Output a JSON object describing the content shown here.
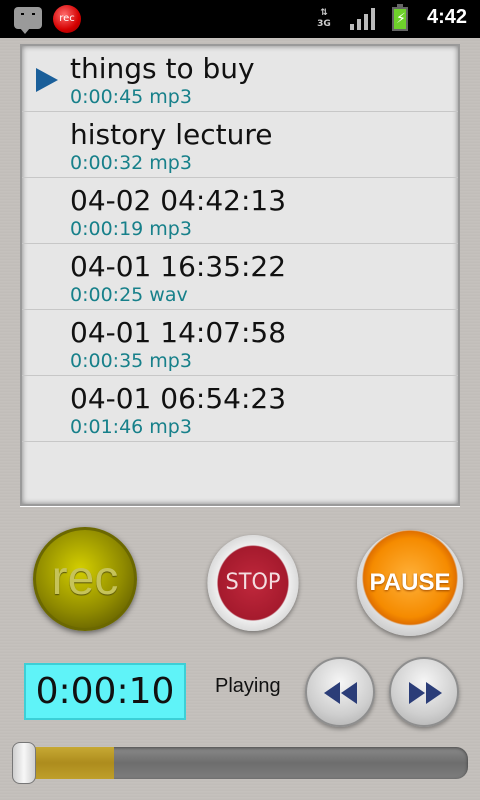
{
  "status_bar": {
    "rec_icon_label": "rec",
    "network_label": "3G",
    "time": "4:42",
    "icons": [
      "message-icon",
      "record-icon",
      "3g-data-icon",
      "signal-icon",
      "battery-charging-icon"
    ]
  },
  "recordings": [
    {
      "title": "things to buy",
      "meta": "0:00:45 mp3",
      "playing": true
    },
    {
      "title": "history lecture",
      "meta": "0:00:32 mp3",
      "playing": false
    },
    {
      "title": "04-02 04:42:13",
      "meta": "0:00:19 mp3",
      "playing": false
    },
    {
      "title": "04-01 16:35:22",
      "meta": "0:00:25 wav",
      "playing": false
    },
    {
      "title": "04-01 14:07:58",
      "meta": "0:00:35 mp3",
      "playing": false
    },
    {
      "title": "04-01 06:54:23",
      "meta": "0:01:46 mp3",
      "playing": false
    }
  ],
  "controls": {
    "rec_label": "rec",
    "stop_label": "STOP",
    "pause_label": "PAUSE",
    "timer": "0:00:10",
    "status": "Playing",
    "progress": 0.22
  },
  "colors": {
    "meta_text": "#17808a",
    "timer_bg": "#5ff3f8",
    "progress_fill": "#b8981f"
  }
}
